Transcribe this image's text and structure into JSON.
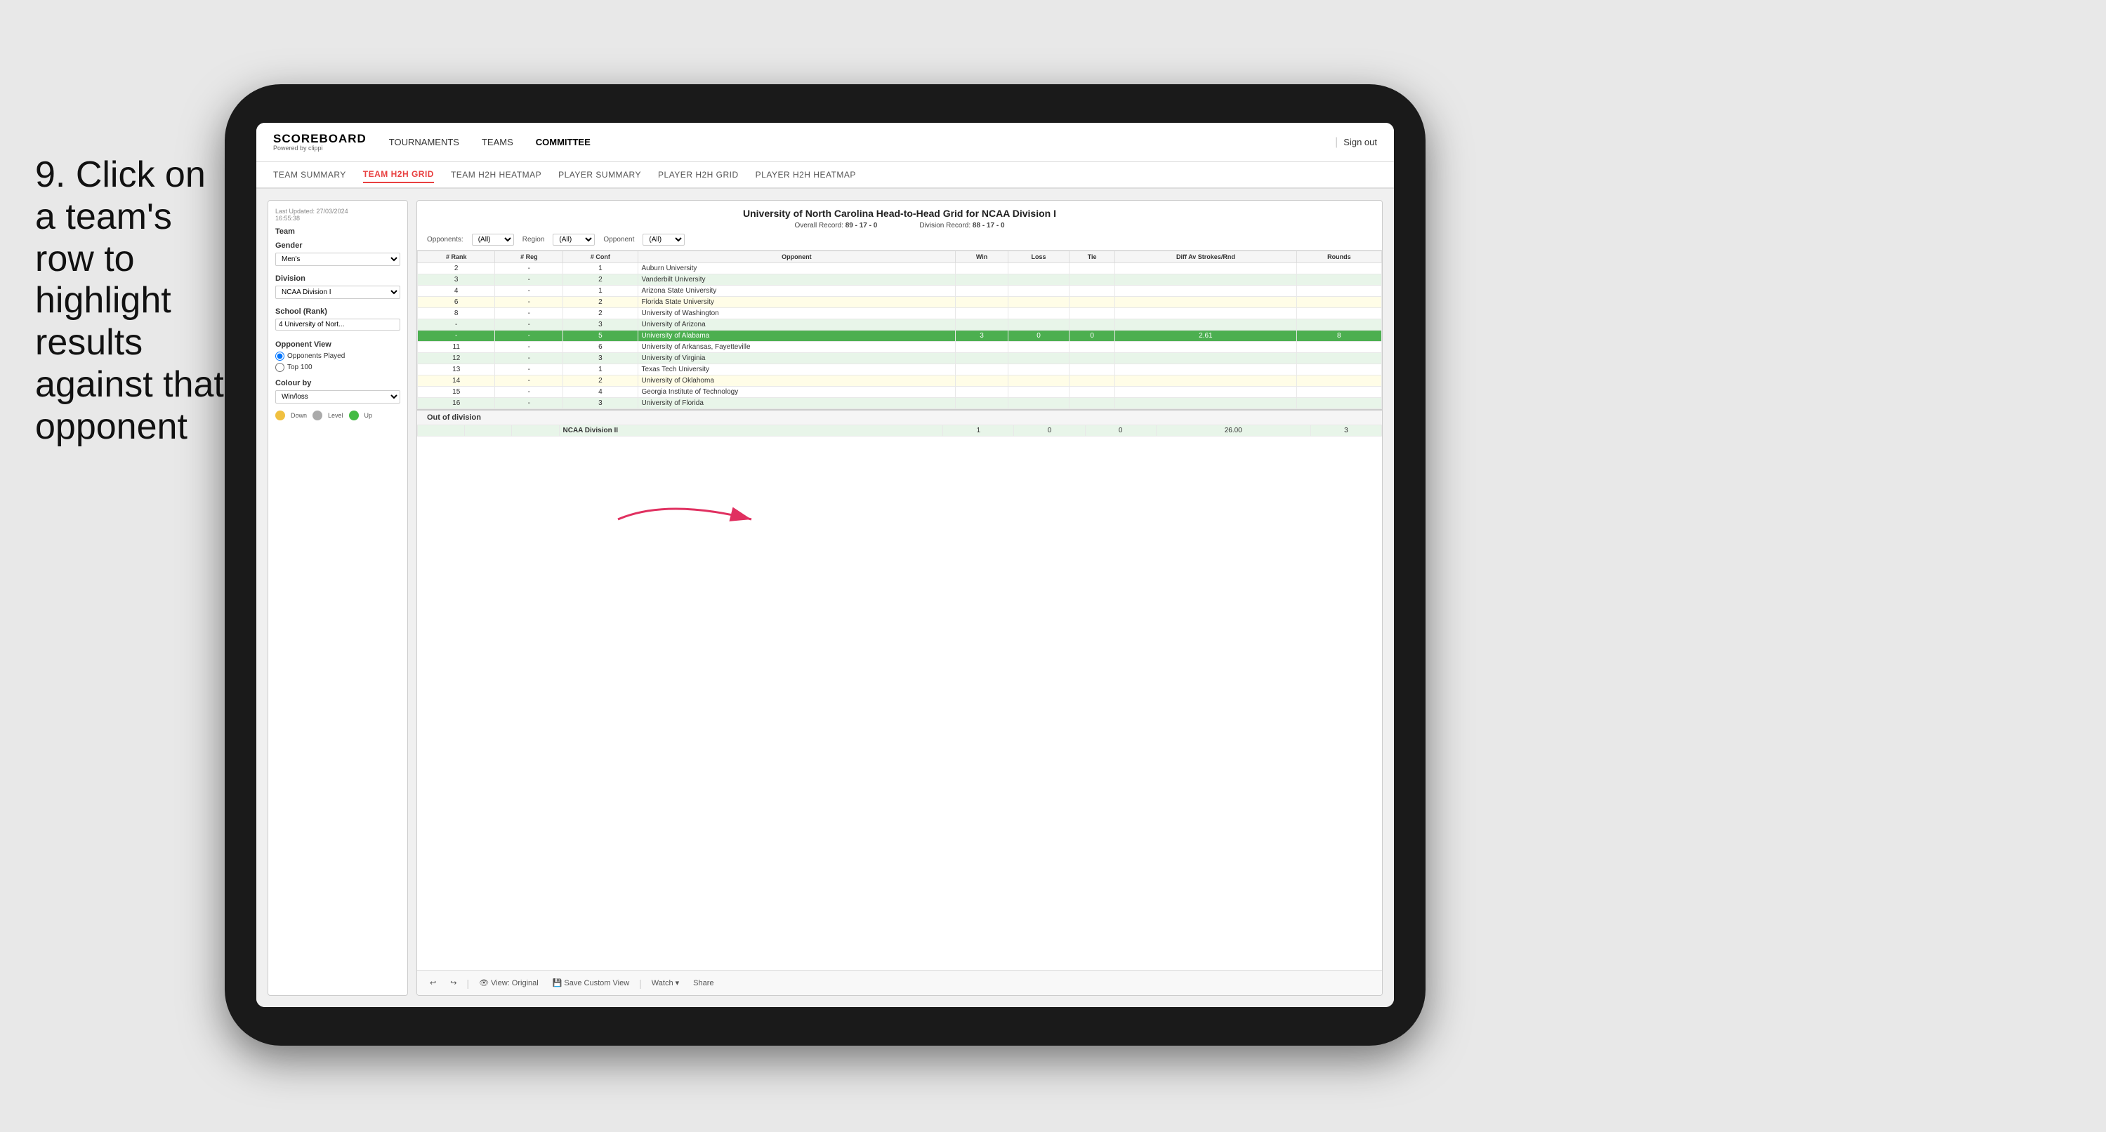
{
  "instruction": {
    "step": "9.",
    "text": "Click on a team's row to highlight results against that opponent"
  },
  "nav": {
    "logo_title": "SCOREBOARD",
    "logo_subtitle": "Powered by clippi",
    "links": [
      "TOURNAMENTS",
      "TEAMS",
      "COMMITTEE"
    ],
    "sign_out": "Sign out"
  },
  "sub_nav": {
    "links": [
      "TEAM SUMMARY",
      "TEAM H2H GRID",
      "TEAM H2H HEATMAP",
      "PLAYER SUMMARY",
      "PLAYER H2H GRID",
      "PLAYER H2H HEATMAP"
    ],
    "active": "TEAM H2H GRID"
  },
  "left_panel": {
    "timestamp": "Last Updated: 27/03/2024",
    "time": "16:55:38",
    "team_label": "Team",
    "gender_label": "Gender",
    "gender_value": "Men's",
    "division_label": "Division",
    "division_value": "NCAA Division I",
    "school_label": "School (Rank)",
    "school_value": "4 University of Nort...",
    "opponent_view_label": "Opponent View",
    "radio_options": [
      "Opponents Played",
      "Top 100"
    ],
    "colour_by_label": "Colour by",
    "colour_value": "Win/loss",
    "legends": [
      {
        "color": "#f0c040",
        "label": "Down"
      },
      {
        "color": "#aaaaaa",
        "label": "Level"
      },
      {
        "color": "#44bb44",
        "label": "Up"
      }
    ]
  },
  "main_table": {
    "title": "University of North Carolina Head-to-Head Grid for NCAA Division I",
    "overall_record_label": "Overall Record:",
    "overall_record": "89 - 17 - 0",
    "division_record_label": "Division Record:",
    "division_record": "88 - 17 - 0",
    "filter_opponents_label": "Opponents:",
    "filter_opponents_value": "(All)",
    "filter_region_label": "Region",
    "filter_region_value": "(All)",
    "filter_opponent_label": "Opponent",
    "filter_opponent_value": "(All)",
    "columns": [
      "# Rank",
      "# Reg",
      "# Conf",
      "Opponent",
      "Win",
      "Loss",
      "Tie",
      "Diff Av Strokes/Rnd",
      "Rounds"
    ],
    "rows": [
      {
        "rank": "2",
        "reg": "-",
        "conf": "1",
        "opponent": "Auburn University",
        "win": "",
        "loss": "",
        "tie": "",
        "diff": "",
        "rounds": "",
        "style": "normal"
      },
      {
        "rank": "3",
        "reg": "-",
        "conf": "2",
        "opponent": "Vanderbilt University",
        "win": "",
        "loss": "",
        "tie": "",
        "diff": "",
        "rounds": "",
        "style": "light-green"
      },
      {
        "rank": "4",
        "reg": "-",
        "conf": "1",
        "opponent": "Arizona State University",
        "win": "",
        "loss": "",
        "tie": "",
        "diff": "",
        "rounds": "",
        "style": "normal"
      },
      {
        "rank": "6",
        "reg": "-",
        "conf": "2",
        "opponent": "Florida State University",
        "win": "",
        "loss": "",
        "tie": "",
        "diff": "",
        "rounds": "",
        "style": "light-yellow"
      },
      {
        "rank": "8",
        "reg": "-",
        "conf": "2",
        "opponent": "University of Washington",
        "win": "",
        "loss": "",
        "tie": "",
        "diff": "",
        "rounds": "",
        "style": "normal"
      },
      {
        "rank": "-",
        "reg": "-",
        "conf": "3",
        "opponent": "University of Arizona",
        "win": "",
        "loss": "",
        "tie": "",
        "diff": "",
        "rounds": "",
        "style": "light-green"
      },
      {
        "rank": "-",
        "reg": "-",
        "conf": "5",
        "opponent": "University of Alabama",
        "win": "3",
        "loss": "0",
        "tie": "0",
        "diff": "2.61",
        "rounds": "8",
        "style": "selected"
      },
      {
        "rank": "11",
        "reg": "-",
        "conf": "6",
        "opponent": "University of Arkansas, Fayetteville",
        "win": "",
        "loss": "",
        "tie": "",
        "diff": "",
        "rounds": "",
        "style": "normal"
      },
      {
        "rank": "12",
        "reg": "-",
        "conf": "3",
        "opponent": "University of Virginia",
        "win": "",
        "loss": "",
        "tie": "",
        "diff": "",
        "rounds": "",
        "style": "light-green"
      },
      {
        "rank": "13",
        "reg": "-",
        "conf": "1",
        "opponent": "Texas Tech University",
        "win": "",
        "loss": "",
        "tie": "",
        "diff": "",
        "rounds": "",
        "style": "normal"
      },
      {
        "rank": "14",
        "reg": "-",
        "conf": "2",
        "opponent": "University of Oklahoma",
        "win": "",
        "loss": "",
        "tie": "",
        "diff": "",
        "rounds": "",
        "style": "light-yellow"
      },
      {
        "rank": "15",
        "reg": "-",
        "conf": "4",
        "opponent": "Georgia Institute of Technology",
        "win": "",
        "loss": "",
        "tie": "",
        "diff": "",
        "rounds": "",
        "style": "normal"
      },
      {
        "rank": "16",
        "reg": "-",
        "conf": "3",
        "opponent": "University of Florida",
        "win": "",
        "loss": "",
        "tie": "",
        "diff": "",
        "rounds": "",
        "style": "light-green"
      }
    ],
    "out_of_division_label": "Out of division",
    "out_of_division_rows": [
      {
        "division": "NCAA Division II",
        "win": "1",
        "loss": "0",
        "tie": "0",
        "diff": "26.00",
        "rounds": "3"
      }
    ]
  },
  "toolbar": {
    "undo": "↩",
    "redo": "↪",
    "view_original": "View: Original",
    "save_custom": "Save Custom View",
    "watch": "Watch ▾",
    "share": "Share"
  }
}
